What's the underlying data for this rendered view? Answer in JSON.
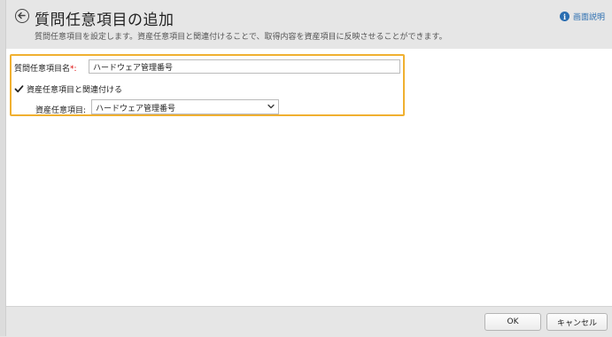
{
  "header": {
    "title": "質問任意項目の追加",
    "subtitle": "質問任意項目を設定します。資産任意項目と関連付けることで、取得内容を資産項目に反映させることができます。",
    "help_label": "画面説明",
    "back_icon": "back-arrow-icon",
    "help_icon": "info-icon"
  },
  "form": {
    "name_label": "質問任意項目名",
    "required_mark": "*:",
    "name_value": "ハードウェア管理番号",
    "link_checkbox_label": "資産任意項目と関連付ける",
    "link_checked": true,
    "asset_label": "資産任意項目:",
    "asset_selected": "ハードウェア管理番号"
  },
  "footer": {
    "ok_label": "OK",
    "cancel_label": "キャンセル"
  },
  "colors": {
    "highlight": "#f0b030",
    "link": "#2a6db0",
    "required": "#dd0000"
  }
}
